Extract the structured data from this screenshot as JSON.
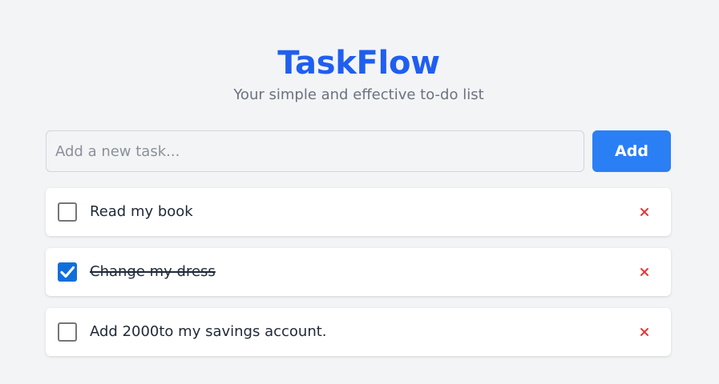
{
  "header": {
    "title": "TaskFlow",
    "subtitle": "Your simple and effective to-do list"
  },
  "input": {
    "value": "",
    "placeholder": "Add a new task...",
    "add_label": "Add"
  },
  "tasks": [
    {
      "label": "Read my book",
      "completed": false,
      "delete_icon": "close-icon"
    },
    {
      "label": "Change my dress",
      "completed": true,
      "delete_icon": "close-icon"
    },
    {
      "label": "Add 2000to my savings account.",
      "completed": false,
      "delete_icon": "close-icon"
    }
  ],
  "colors": {
    "brand": "#1f5ff0",
    "button": "#2b7ff5",
    "checkbox_checked": "#0e6fdb",
    "delete": "#e23a3a",
    "background": "#f3f4f6"
  }
}
